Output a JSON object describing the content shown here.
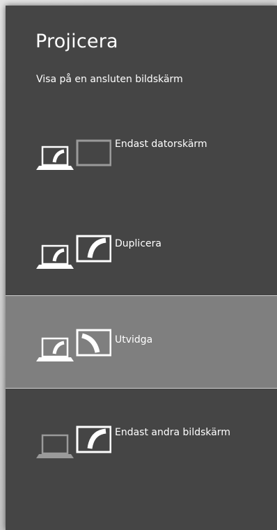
{
  "panel": {
    "title": "Projicera",
    "subtitle": "Visa på en ansluten bildskärm"
  },
  "options": [
    {
      "label": "Endast datorskärm",
      "icon": "pc-screen-only-icon",
      "selected": false
    },
    {
      "label": "Duplicera",
      "icon": "duplicate-display-icon",
      "selected": false
    },
    {
      "label": "Utvidga",
      "icon": "extend-display-icon",
      "selected": true
    },
    {
      "label": "Endast andra bildskärm",
      "icon": "second-screen-only-icon",
      "selected": false
    }
  ],
  "colors": {
    "panel_bg": "#454545",
    "selected_bg": "#7f7f7f",
    "text": "#ffffff",
    "inactive_icon": "#9a9a9a"
  }
}
